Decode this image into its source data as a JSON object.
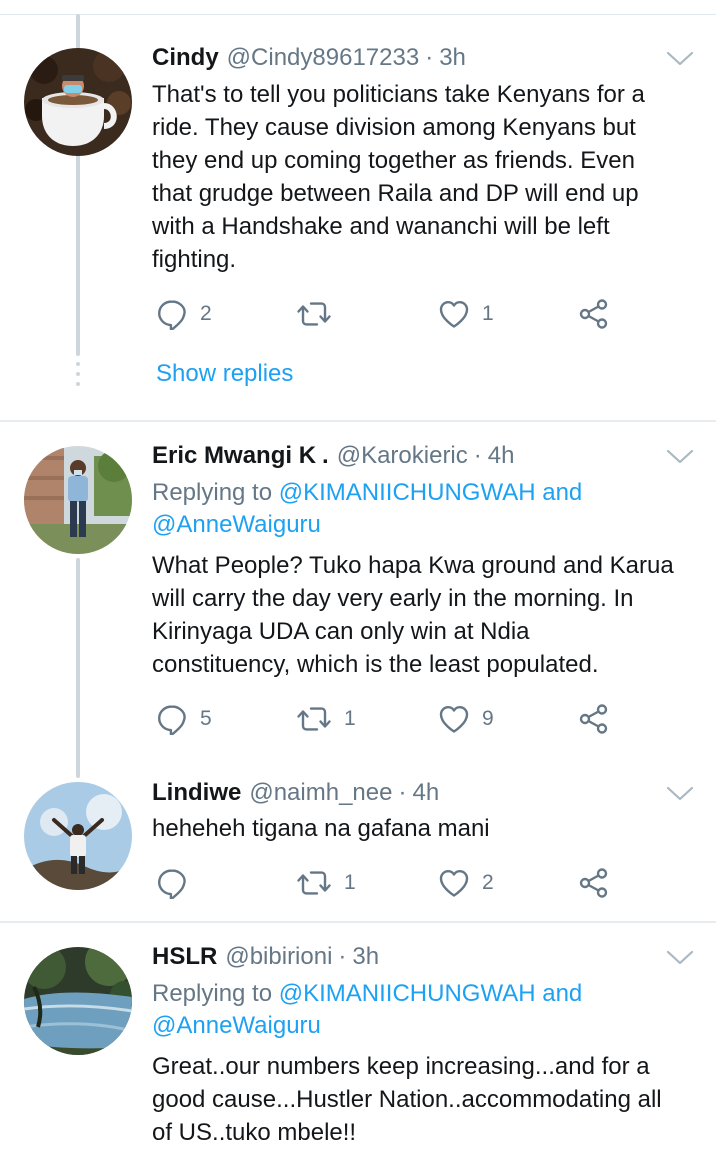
{
  "tweets": [
    {
      "name": "Cindy",
      "handle": "@Cindy89617233",
      "sep": "·",
      "time": "3h",
      "text": "That's to tell you politicians take Kenyans for a\nride. They cause division among Kenyans but\nthey end up coming together as friends. Even\nthat grudge between Raila and DP will end up\nwith a Handshake and wananchi will be left\nfighting.",
      "replies": "2",
      "retweets": "",
      "likes": "1",
      "show_replies": "Show replies"
    },
    {
      "name": "Eric Mwangi K",
      "name_suffix": ".",
      "handle": "@Karokieric",
      "sep": "·",
      "time": "4h",
      "replying_to": "Replying to",
      "mentions": "@KIMANIICHUNGWAH and",
      "mentions2": "@AnneWaiguru",
      "text": "What People? Tuko hapa Kwa ground and Karua\nwill carry the day very early in the morning. In\nKirinyaga UDA  can only win at Ndia\nconstituency, which is the least populated.",
      "replies": "5",
      "retweets": "1",
      "likes": "9"
    },
    {
      "name": "Lindiwe",
      "handle": "@naimh_nee",
      "sep": "·",
      "time": "4h",
      "text": "heheheh tigana na gafana mani",
      "replies": "",
      "retweets": "1",
      "likes": "2"
    },
    {
      "name": "HSLR",
      "handle": "@bibirioni",
      "sep": "·",
      "time": "3h",
      "replying_to": "Replying to",
      "mentions": "@KIMANIICHUNGWAH and",
      "mentions2": "@AnneWaiguru",
      "text": "Great..our numbers keep increasing...and for a\ngood cause...Hustler Nation..accommodating all\nof US..tuko mbele!!"
    }
  ],
  "icons": {
    "reply": "reply-icon",
    "retweet": "retweet-icon",
    "like": "heart-icon",
    "share": "share-icon",
    "more": "chevron-down-icon"
  },
  "colors": {
    "accent": "#1da1f2",
    "secondary_text": "#657786",
    "primary_text": "#14171a",
    "divider": "#e6ecf0"
  }
}
